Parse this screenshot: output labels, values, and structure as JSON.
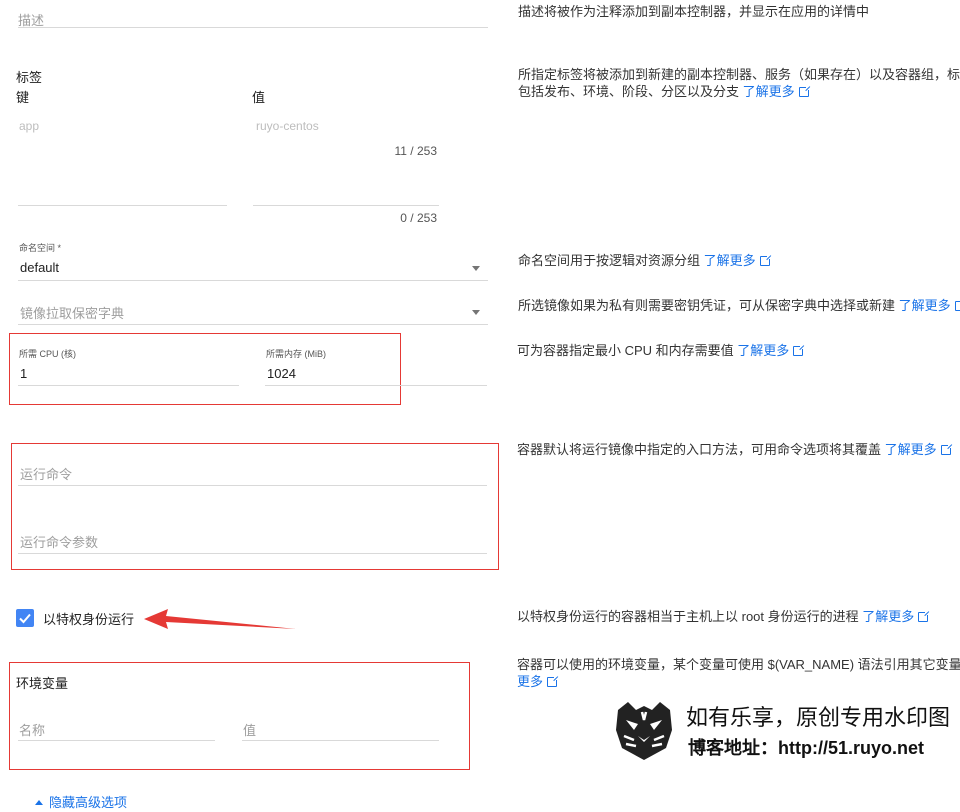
{
  "description": {
    "placeholder": "描述",
    "help": "描述将被作为注释添加到副本控制器，并显示在应用的详情中"
  },
  "labels": {
    "title": "标签",
    "key_header": "键",
    "value_header": "值",
    "rows": [
      {
        "key_placeholder": "app",
        "value_placeholder": "ruyo-centos",
        "counter": "11 / 253"
      },
      {
        "key_placeholder": "",
        "value_placeholder": "",
        "counter": "0 / 253"
      }
    ],
    "help_line1": "所指定标签将被添加到新建的副本控制器、服务（如果存在）以及容器组，标签",
    "help_line2": "包括发布、环境、阶段、分区以及分支",
    "help_link": "了解更多"
  },
  "namespace": {
    "label": "命名空间 *",
    "value": "default",
    "help": "命名空间用于按逻辑对资源分组",
    "help_link": "了解更多"
  },
  "image_pull_secret": {
    "placeholder": "镜像拉取保密字典",
    "help": "所选镜像如果为私有则需要密钥凭证，可从保密字典中选择或新建",
    "help_link": "了解更多"
  },
  "resources": {
    "cpu_label": "所需 CPU (核)",
    "cpu_value": "1",
    "memory_label": "所需内存 (MiB)",
    "memory_value": "1024",
    "help": "可为容器指定最小 CPU 和内存需要值",
    "help_link": "了解更多"
  },
  "command": {
    "run_command_placeholder": "运行命令",
    "run_args_placeholder": "运行命令参数",
    "help": "容器默认将运行镜像中指定的入口方法，可用命令选项将其覆盖",
    "help_link": "了解更多"
  },
  "privileged": {
    "label": "以特权身份运行",
    "checked": true,
    "help": "以特权身份运行的容器相当于主机上以 root 身份运行的进程",
    "help_link": "了解更多"
  },
  "env": {
    "title": "环境变量",
    "name_placeholder": "名称",
    "value_placeholder": "值",
    "help_line1": "容器可以使用的环境变量，某个变量可使用 $(VAR_NAME) 语法引用其它变量",
    "help_link_part1": "了",
    "help_link_part2": "更多"
  },
  "advanced_toggle": "隐藏高级选项",
  "watermark": {
    "line1": "如有乐享，原创专用水印图",
    "line2": "博客地址：http://51.ruyo.net"
  },
  "colors": {
    "accent": "#1a73e8",
    "annotation_red": "#e53935"
  }
}
